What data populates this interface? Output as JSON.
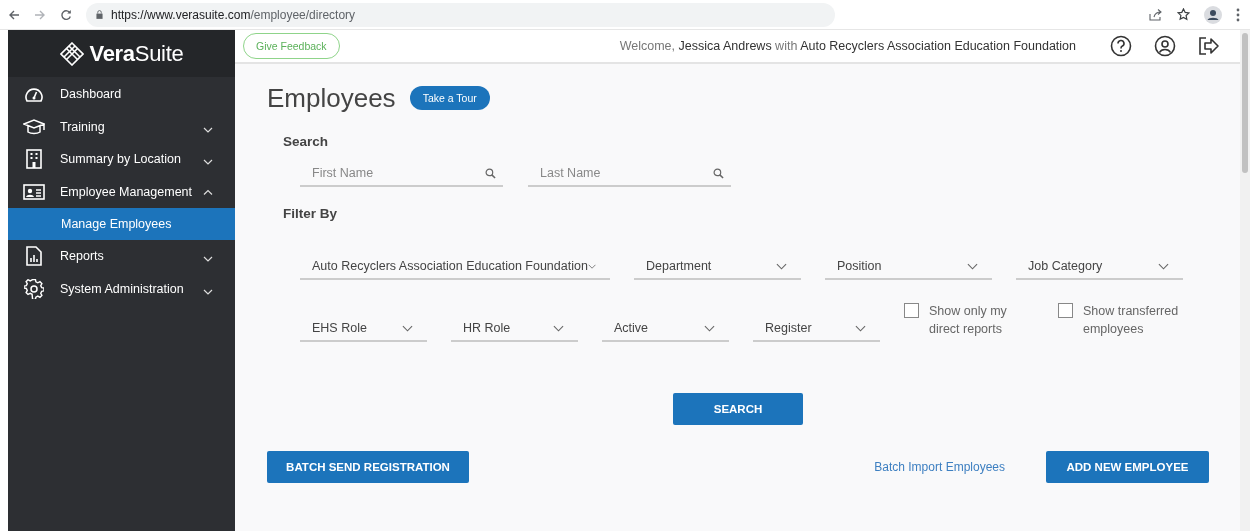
{
  "browser": {
    "url_host": "https://www.verasuite.com",
    "url_path": "/employee/directory"
  },
  "sidebar": {
    "logo": "**Vera**Suite",
    "items": [
      {
        "label": "Dashboard"
      },
      {
        "label": "Training",
        "expanded": false
      },
      {
        "label": "Summary by Location",
        "expanded": false
      },
      {
        "label": "Employee Management",
        "expanded": true,
        "children": [
          {
            "label": "Manage Employees",
            "selected": true
          }
        ]
      },
      {
        "label": "Reports",
        "expanded": false
      },
      {
        "label": "System Administration",
        "expanded": false
      }
    ]
  },
  "header": {
    "feedback_button": "Give Feedback",
    "welcome": "Welcome, ",
    "user": "Jessica Andrews",
    "with": " with ",
    "organization": "Auto Recyclers Association Education Foundation"
  },
  "page": {
    "title": "Employees",
    "tour_button": "Take a Tour",
    "search_label": "Search",
    "search_fields": [
      {
        "placeholder": "First Name"
      },
      {
        "placeholder": "Last Name"
      }
    ],
    "filter_label": "Filter By",
    "filter_rows": [
      [
        {
          "kind": "dropdown",
          "value": "Auto Recyclers Association Education Foundation"
        },
        {
          "kind": "dropdown",
          "value": "Department"
        },
        {
          "kind": "dropdown",
          "value": "Position"
        },
        {
          "kind": "dropdown",
          "value": "Job Category"
        }
      ],
      [
        {
          "kind": "dropdown",
          "value": "EHS Role"
        },
        {
          "kind": "dropdown",
          "value": "HR Role"
        },
        {
          "kind": "dropdown",
          "value": "Active"
        },
        {
          "kind": "dropdown",
          "value": "Register"
        },
        {
          "kind": "checkbox",
          "label": "Show only my direct reports",
          "checked": false
        },
        {
          "kind": "checkbox",
          "label": "Show transferred employees",
          "checked": false
        }
      ]
    ],
    "search_button": "SEARCH",
    "batch_send_button": "BATCH SEND REGISTRATION",
    "batch_import_link": "Batch Import Employees",
    "add_button": "ADD NEW EMPLOYEE"
  }
}
